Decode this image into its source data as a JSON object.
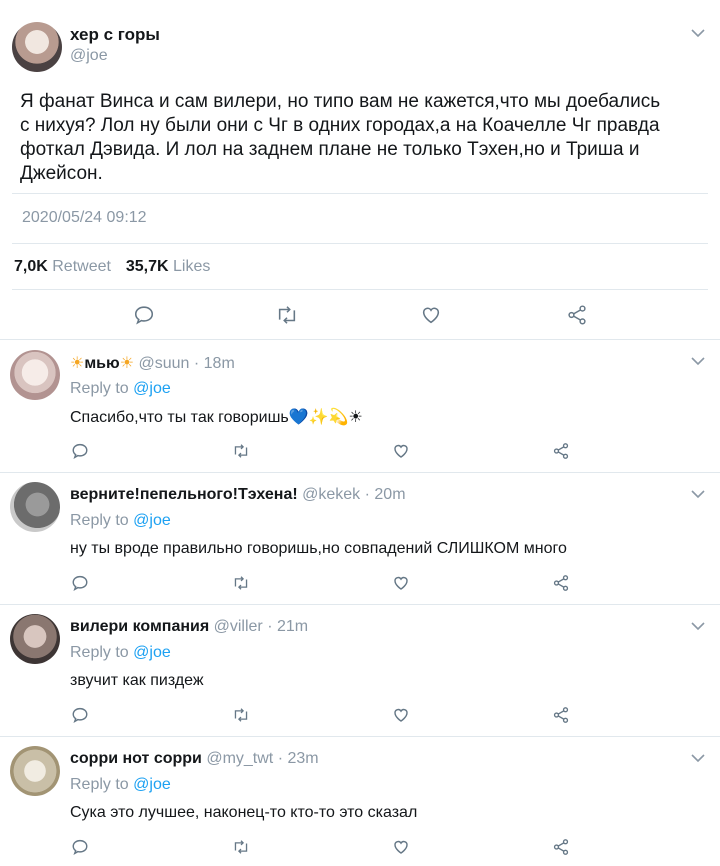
{
  "main": {
    "author_name": "хер с горы",
    "author_handle": "@joe",
    "text_lines": [
      "Я фанат Винса и сам вилери, но типо вам не кажется,что мы доебались",
      "с нихуя? Лол ну были они с Чг в одних городах,а на Коачелле Чг правда",
      "фоткал Дэвида. И лол на заднем плане не только Тэхен,но и Триша и",
      "Джейсон."
    ],
    "timestamp": "2020/05/24 09:12",
    "retweets_count": "7,0K",
    "retweets_label": "Retweet",
    "likes_count": "35,7K",
    "likes_label": "Likes"
  },
  "replies": [
    {
      "name": "мью",
      "handle": "@suun",
      "time": "· 18m",
      "reply_prefix": "Reply to",
      "reply_to": "@joe",
      "text": "Спасибо,что ты так говоришь",
      "emoji_tail": "💙✨💫☀"
    },
    {
      "name": "верните!пепельного!Тэхена!",
      "handle": "@kekek",
      "time": "· 20m",
      "reply_prefix": "Reply to",
      "reply_to": "@joe",
      "text": "ну ты вроде правильно говоришь,но совпадений СЛИШКОМ много"
    },
    {
      "name": "вилери компания",
      "handle": "@viller",
      "time": "· 21m",
      "reply_prefix": "Reply to",
      "reply_to": "@joe",
      "text": "звучит как пиздеж"
    },
    {
      "name": "сорри нот сорри",
      "handle": "@my_twt",
      "time": "· 23m",
      "reply_prefix": "Reply to",
      "reply_to": "@joe",
      "text": "Сука это лучшее, наконец-то кто-то это сказал"
    }
  ],
  "colors": {
    "accent": "#1da1f2",
    "muted": "#8b98a5",
    "divider": "#e1e8ed"
  },
  "icons": [
    "chevron-down-icon",
    "reply-icon",
    "retweet-icon",
    "like-icon",
    "share-icon",
    "sun-icon"
  ]
}
